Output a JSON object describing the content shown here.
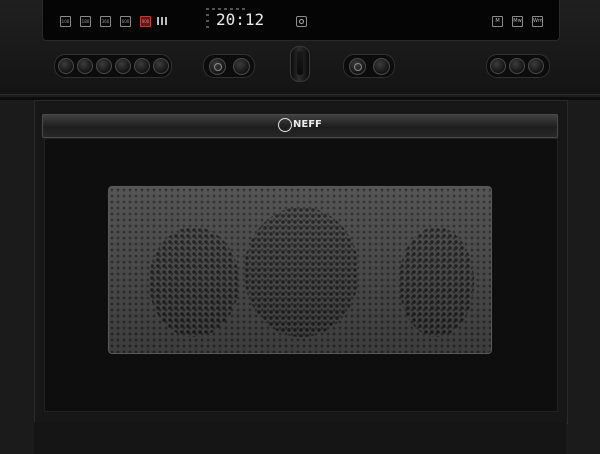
{
  "display": {
    "clock": "20:12",
    "left_icons": [
      "100",
      "180",
      "360",
      "600",
      "900"
    ],
    "right_icons": [
      "M",
      "Mw",
      "Wm"
    ]
  },
  "brand": {
    "name": "NEFF"
  },
  "icons": {
    "power": "power-icon",
    "main_dial": "main-dial"
  },
  "colors": {
    "body": "#1b1b1b",
    "display": "#050505",
    "active_icon": "#c23b2c",
    "clock_text": "#e9e9e9"
  }
}
